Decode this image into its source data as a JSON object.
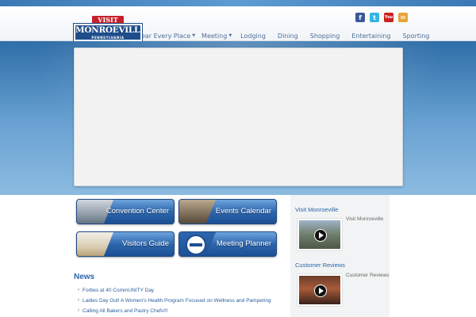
{
  "social": {
    "facebook": "f",
    "twitter": "t",
    "youtube": "You",
    "email": "✉"
  },
  "logo": {
    "visit": "VISIT",
    "name": "MONROEVILLE",
    "state": "PENNSYLVANIA"
  },
  "nav": {
    "items": [
      {
        "label": "Near Every Place",
        "has_dropdown": true
      },
      {
        "label": "Meeting",
        "has_dropdown": true
      },
      {
        "label": "Lodging",
        "has_dropdown": false
      },
      {
        "label": "Dining",
        "has_dropdown": false
      },
      {
        "label": "Shopping",
        "has_dropdown": false
      },
      {
        "label": "Entertaining",
        "has_dropdown": false
      },
      {
        "label": "Sporting",
        "has_dropdown": false
      }
    ],
    "caret": "▼"
  },
  "features": {
    "convention": "Convention Center",
    "events": "Events Calendar",
    "visitors": "Visitors Guide",
    "planner": "Meeting Planner"
  },
  "news": {
    "title": "News",
    "arrow": "›",
    "items": [
      "Forbes at 40 CommUNITY Day",
      "Ladies Day Out! A Women's Health Program Focused on Wellness and Pampering",
      "Calling All Bakers and Pastry Chefs!!!"
    ]
  },
  "sidebar": {
    "visit_heading": "Visit Monroeville",
    "visit_caption": "Visit Monroeville",
    "reviews_heading": "Customer Reviews",
    "reviews_caption": "Customer Reviews"
  },
  "colors": {
    "brand_blue": "#1f4c8a",
    "brand_red": "#c8202a",
    "link_blue": "#2b66a8",
    "nav_text": "#4f6f96"
  }
}
